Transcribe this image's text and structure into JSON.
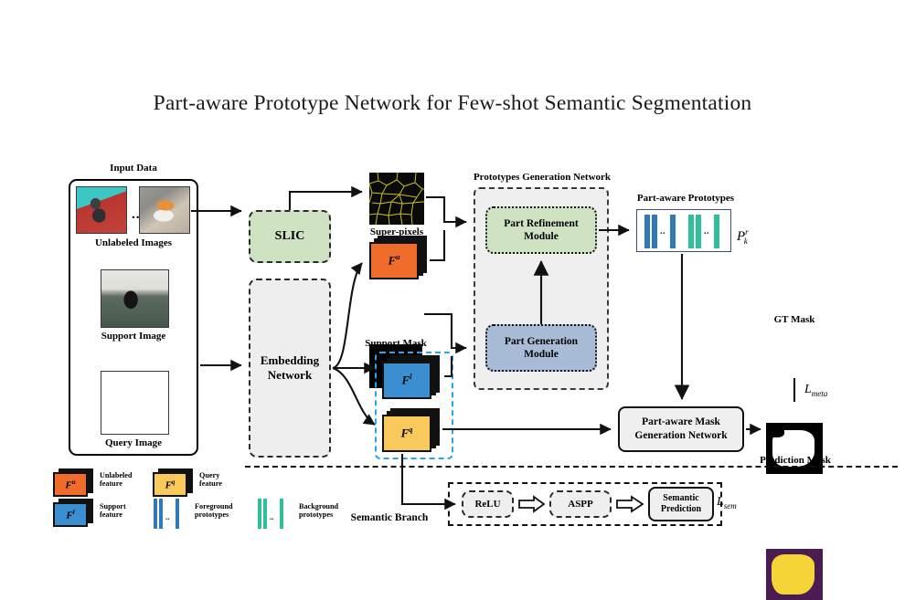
{
  "title": "Part-aware Prototype Network for Few-shot Semantic Segmentation",
  "sections": {
    "input_data": "Input Data",
    "prototypes_generation_network": "Prototypes Generation Network",
    "part_aware_prototypes": "Part-aware Prototypes",
    "semantic_branch": "Semantic Branch"
  },
  "inputs": {
    "unlabeled_images": "Unlabeled Images",
    "support_image": "Support Image",
    "query_image": "Query Image",
    "ellipsis": "..."
  },
  "modules": {
    "slic": "SLIC",
    "embedding_network": "Embedding\nNetwork",
    "embedding_network_line1": "Embedding",
    "embedding_network_line2": "Network",
    "part_refinement_line1": "Part Refinement",
    "part_refinement_line2": "Module",
    "part_generation_line1": "Part Generation",
    "part_generation_line2": "Module",
    "mask_generation_line1": "Part-aware Mask",
    "mask_generation_line2": "Generation Network",
    "relu": "ReLU",
    "aspp": "ASPP",
    "semantic_prediction_line1": "Semantic",
    "semantic_prediction_line2": "Prediction"
  },
  "features": {
    "unlabeled": "Fᵘ",
    "support": "Fℓ",
    "query": "Fᵠ",
    "unlabeled_base": "F",
    "unlabeled_sup": "u",
    "support_base": "F",
    "support_sup": "l",
    "query_base": "F",
    "query_sup": "q"
  },
  "images": {
    "superpixels": "Super-pixels",
    "support_mask": "Support Mask",
    "gt_mask": "GT Mask",
    "prediction_mask": "Prediction Mask"
  },
  "math": {
    "prototypes_symbol_base": "P",
    "prototypes_symbol_sup": "r",
    "prototypes_symbol_sub": "k",
    "loss_meta_base": "L",
    "loss_meta_sub": "meta",
    "loss_sem_base": "L",
    "loss_sem_sub": "sem"
  },
  "legend": [
    {
      "swatch": "unlabeled-feature-cube",
      "symbol_base": "F",
      "symbol_sup": "u",
      "line1": "Unlabeled",
      "line2": "feature",
      "color": "#ef6c2a"
    },
    {
      "swatch": "query-feature-cube",
      "symbol_base": "F",
      "symbol_sup": "q",
      "line1": "Query",
      "line2": "feature",
      "color": "#f9c95c"
    },
    {
      "swatch": "support-feature-cube",
      "symbol_base": "F",
      "symbol_sup": "l",
      "line1": "Support",
      "line2": "feature",
      "color": "#3b8fd0"
    },
    {
      "swatch": "foreground-prototype-bars",
      "symbol_base": "",
      "symbol_sup": "",
      "line1": "Foreground",
      "line2": "prototypes",
      "color": "#2e79b8"
    },
    {
      "swatch": "background-prototype-bars",
      "symbol_base": "",
      "symbol_sup": "",
      "line1": "Background",
      "line2": "prototypes",
      "color": "#2fbf9a"
    }
  ],
  "colors": {
    "unlabeled_feature": "#ef6c2a",
    "support_feature": "#3b8fd0",
    "query_feature": "#f9c95c",
    "foreground_prototype": "#2e79b8",
    "background_prototype": "#2fbf9a",
    "part_refinement_fill": "#cfe3c2",
    "part_generation_fill": "#a8bcd8",
    "slic_fill": "#cfe3c2",
    "module_gray": "#eeeeee",
    "cyan_group_border": "#22a7f0",
    "prediction_mask_bg": "#4a1c52",
    "prediction_mask_fg": "#f5d438",
    "superpixel_bg": "#0a0a08",
    "superpixel_lines": "#c9c021"
  },
  "prototype_bars": {
    "foreground_dots": "..",
    "background_dots": ".."
  }
}
